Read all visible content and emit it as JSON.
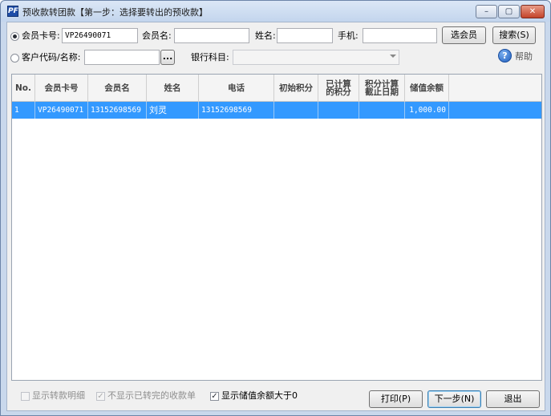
{
  "window": {
    "title": "预收款转团款【第一步：选择要转出的预收款】",
    "app_icon": "PF",
    "controls": {
      "min": "–",
      "max": "▢",
      "close": "✕"
    }
  },
  "search": {
    "member_card_label": "会员卡号:",
    "member_card_value": "VP26490071",
    "member_name_label": "会员名:",
    "member_name_value": "",
    "name_label": "姓名:",
    "name_value": "",
    "mobile_label": "手机:",
    "mobile_value": "",
    "select_member_button": "选会员",
    "search_button": "搜索(S)",
    "customer_code_label": "客户代码/名称:",
    "customer_code_value": "",
    "browse_button": "...",
    "bank_account_label": "银行科目:",
    "bank_account_value": "",
    "help_label": "帮助",
    "help_icon": "?"
  },
  "grid": {
    "columns": [
      "No.",
      "会员卡号",
      "会员名",
      "姓名",
      "电话",
      "初始积分",
      "已计算的积分",
      "积分计算截止日期",
      "储值余额"
    ],
    "rows": [
      [
        "1",
        "VP26490071",
        "13152698569",
        "刘灵",
        "13152698569",
        "",
        "",
        "",
        "1,000.00"
      ]
    ]
  },
  "footer": {
    "show_detail_label": "显示转款明细",
    "hide_transferred_label": "不显示已转完的收款单",
    "show_balance_label": "显示储值余额大于0",
    "print_button": "打印(P)",
    "next_button": "下一步(N)",
    "exit_button": "退出",
    "check_mark": "✓"
  }
}
